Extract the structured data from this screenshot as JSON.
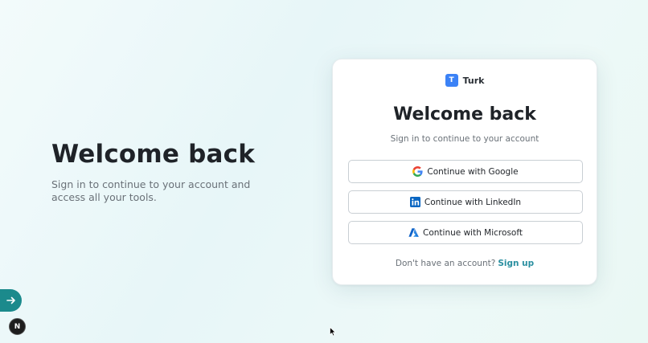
{
  "hero": {
    "title": "Welcome back",
    "subtitle": "Sign in to continue to your account and access all your tools."
  },
  "card": {
    "brand_logo_letter": "T",
    "brand_name": "Turk",
    "title": "Welcome back",
    "subtitle": "Sign in to continue to your account",
    "buttons": {
      "google": "Continue with Google",
      "linkedin": "Continue with LinkedIn",
      "microsoft": "Continue with Microsoft"
    },
    "footer_text": "Don't have an account?",
    "signup_link": "Sign up"
  },
  "floating": {
    "dev_badge_letter": "N"
  },
  "colors": {
    "accent": "#2a8fa0",
    "brand_logo": "#3b82f6",
    "fab": "#1b8a8c"
  },
  "icons": [
    "google-icon",
    "linkedin-icon",
    "microsoft-azure-icon",
    "arrow-right-icon",
    "cursor-icon"
  ]
}
